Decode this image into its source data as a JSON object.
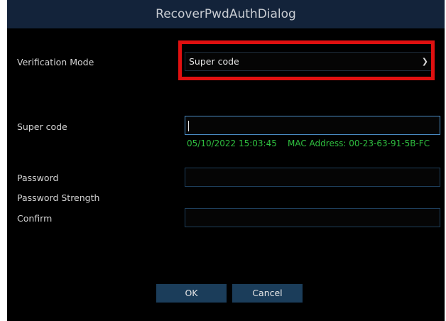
{
  "dialog": {
    "title": "RecoverPwdAuthDialog"
  },
  "form": {
    "verification_mode": {
      "label": "Verification Mode",
      "value": "Super code",
      "icon": "chevron-down-icon"
    },
    "super_code": {
      "label": "Super code",
      "value": ""
    },
    "info": {
      "datetime": "05/10/2022 15:03:45",
      "mac_address": "MAC Address: 00-23-63-91-5B-FC"
    },
    "password": {
      "label": "Password",
      "value": ""
    },
    "password_strength": {
      "label": "Password Strength"
    },
    "confirm": {
      "label": "Confirm",
      "value": ""
    }
  },
  "buttons": {
    "ok": "OK",
    "cancel": "Cancel"
  },
  "colors": {
    "title_bar": "#13233a",
    "info_text": "#2fbf3f",
    "button": "#1b3d5a",
    "highlight": "#e01010"
  }
}
